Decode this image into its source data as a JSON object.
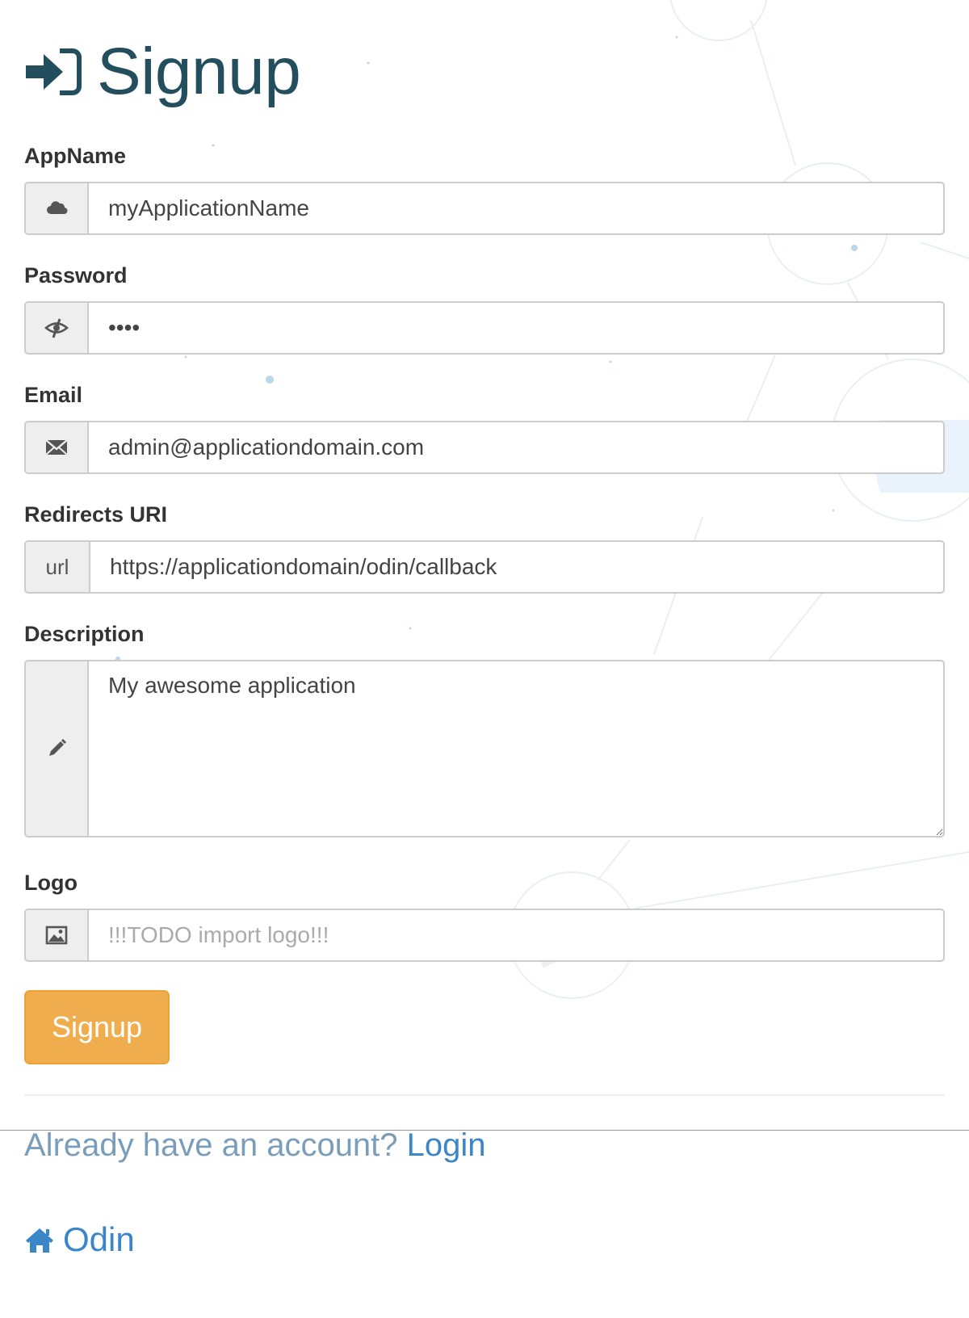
{
  "page": {
    "title": "Signup",
    "title_icon": "sign-in-icon"
  },
  "form": {
    "appname": {
      "label": "AppName",
      "icon": "cloud-icon",
      "value": "myApplicationName",
      "placeholder": ""
    },
    "password": {
      "label": "Password",
      "icon": "eye-slash-icon",
      "value": "••••",
      "placeholder": ""
    },
    "email": {
      "label": "Email",
      "icon": "envelope-icon",
      "value": "admin@applicationdomain.com",
      "placeholder": ""
    },
    "redirects": {
      "label": "Redirects URI",
      "addon_text": "url",
      "value": "https://applicationdomain/odin/callback",
      "placeholder": ""
    },
    "description": {
      "label": "Description",
      "icon": "pencil-icon",
      "value": "My awesome application"
    },
    "logo": {
      "label": "Logo",
      "icon": "picture-icon",
      "value": "",
      "placeholder": "!!!TODO import logo!!!"
    },
    "submit_label": "Signup"
  },
  "footer": {
    "account_prompt": "Already have an account?",
    "login_label": "Login",
    "home_label": "Odin",
    "home_icon": "home-icon"
  },
  "colors": {
    "title": "#234e5e",
    "button": "#f0ad4e",
    "link": "#3a86c8",
    "prompt": "#7a9dbb"
  }
}
